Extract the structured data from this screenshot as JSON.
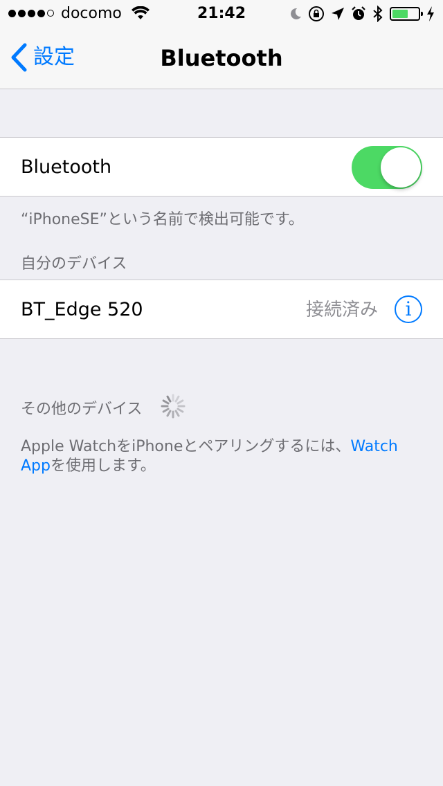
{
  "status_bar": {
    "carrier": "docomo",
    "time": "21:42",
    "signal_bars_filled": 4,
    "signal_bars_total": 5,
    "battery_level": 0.6,
    "icons": [
      "wifi-icon",
      "moon-icon",
      "rotation-lock-icon",
      "location-icon",
      "alarm-icon",
      "bluetooth-icon",
      "battery-icon",
      "charging-icon"
    ]
  },
  "nav": {
    "back_label": "設定",
    "title": "Bluetooth"
  },
  "bluetooth_cell": {
    "label": "Bluetooth",
    "enabled": true
  },
  "discoverable_text": "“iPhoneSE”という名前で検出可能です。",
  "my_devices": {
    "header": "自分のデバイス",
    "devices": [
      {
        "name": "BT_Edge 520",
        "status": "接続済み"
      }
    ]
  },
  "other_devices": {
    "header": "その他のデバイス"
  },
  "pairing_note": {
    "text_before": "Apple WatchをiPhoneとペアリングするには、",
    "link": "Watch App",
    "text_after": "を使用します。"
  },
  "colors": {
    "accent": "#007aff",
    "toggle_on": "#4cd964",
    "background": "#efeff4",
    "secondary_text": "#6d6d72"
  }
}
